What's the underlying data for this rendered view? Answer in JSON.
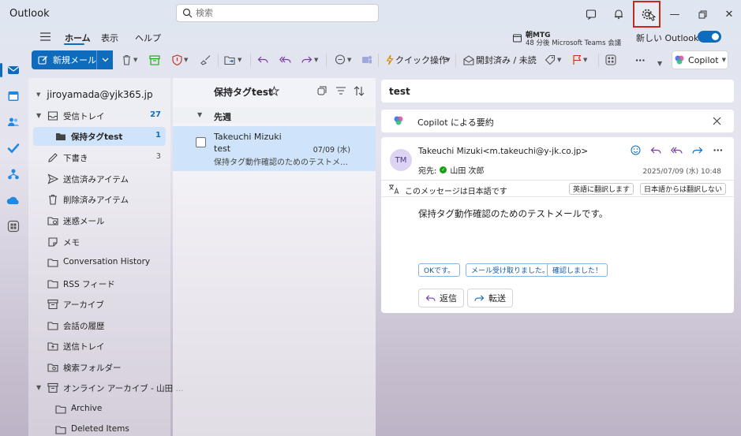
{
  "app": {
    "title": "Outlook"
  },
  "search": {
    "placeholder": "検索"
  },
  "ribbon": {
    "tabs": [
      {
        "label": "ホーム"
      },
      {
        "label": "表示"
      },
      {
        "label": "ヘルプ"
      }
    ],
    "meeting": {
      "title": "朝MTG",
      "subtitle": "48 分後 Microsoft Teams 会議"
    },
    "new_outlook_label": "新しい Outlook",
    "new_mail_label": "新規メール",
    "quick_steps_label": "クイック操作",
    "read_unread_label": "開封済み / 未読",
    "copilot_label": "Copilot"
  },
  "folders": {
    "account": "jiroyamada@yjk365.jp",
    "items": [
      {
        "label": "受信トレイ",
        "count": "27"
      },
      {
        "label": "保持タグtest",
        "count": "1"
      },
      {
        "label": "下書き",
        "count": "3"
      },
      {
        "label": "送信済みアイテム",
        "count": ""
      },
      {
        "label": "削除済みアイテム",
        "count": ""
      },
      {
        "label": "迷惑メール",
        "count": ""
      },
      {
        "label": "メモ",
        "count": ""
      },
      {
        "label": "Conversation History",
        "count": ""
      },
      {
        "label": "RSS フィード",
        "count": ""
      },
      {
        "label": "アーカイブ",
        "count": ""
      },
      {
        "label": "会話の履歴",
        "count": ""
      },
      {
        "label": "送信トレイ",
        "count": ""
      },
      {
        "label": "検索フォルダー",
        "count": ""
      },
      {
        "label": "オンライン アーカイブ - 山田 ...",
        "count": ""
      },
      {
        "label": "Archive",
        "count": ""
      },
      {
        "label": "Deleted Items",
        "count": ""
      }
    ]
  },
  "list": {
    "title": "保持タグtest",
    "group": "先週",
    "messages": [
      {
        "from": "Takeuchi Mizuki",
        "subject": "test",
        "date": "07/09 (水)",
        "preview": "保持タグ動作確認のためのテストメールで..."
      }
    ]
  },
  "reading": {
    "subject": "test",
    "copilot_summary_label": "Copilot による要約",
    "avatar_initials": "TM",
    "sender": "Takeuchi Mizuki<m.takeuchi@y-jk.co.jp>",
    "to_label": "宛先:",
    "to_name": "山田 次郎",
    "date": "2025/07/09 (水) 10:48",
    "translate_notice": "このメッセージは日本語です",
    "translate_to_english": "英語に翻訳します",
    "never_translate": "日本語からは翻訳しない",
    "body": "保持タグ動作確認のためのテストメールです。",
    "quick_replies": [
      "OKです。",
      "メール受け取りました。",
      "確認しました！"
    ],
    "reply_label": "返信",
    "forward_label": "転送"
  },
  "colors": {
    "accent": "#0f6cbd",
    "selected": "#cfe4fa",
    "highlight_border": "#c42b1c"
  }
}
